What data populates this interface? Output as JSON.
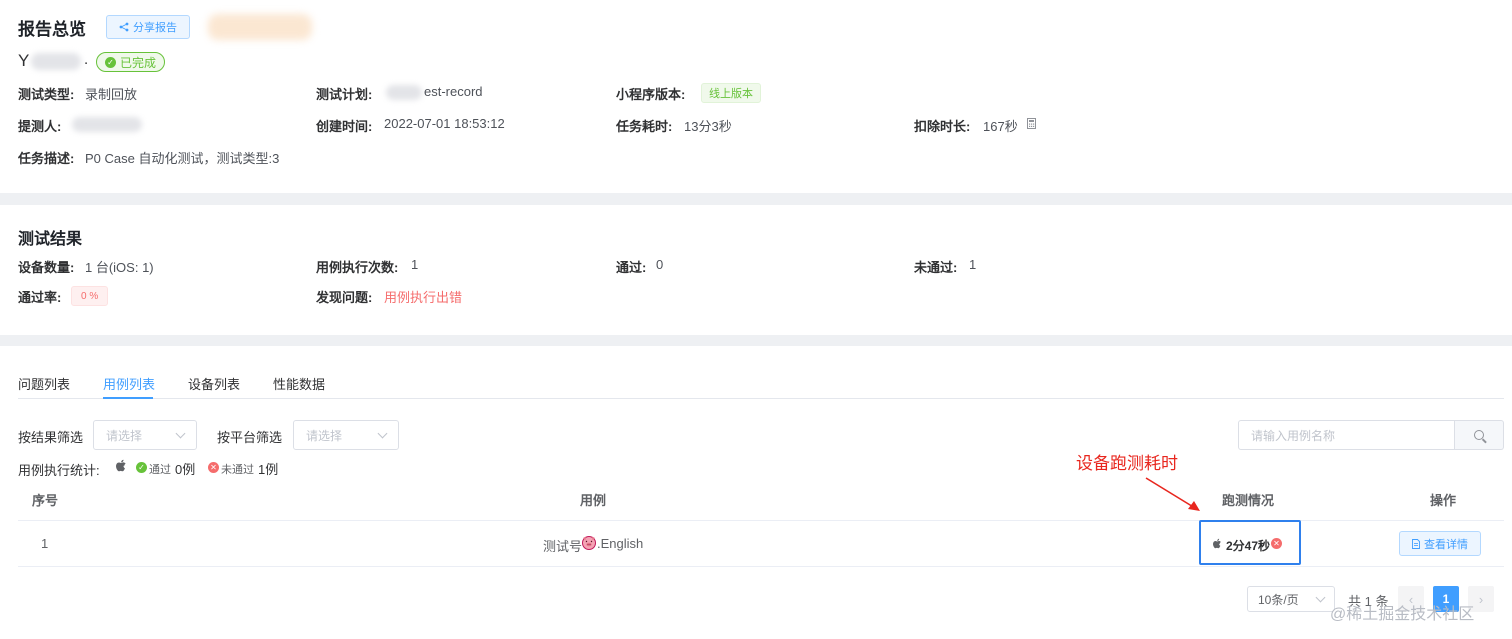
{
  "overview": {
    "title": "报告总览",
    "share_label": "分享报告",
    "name_initial": "Y",
    "name_suffix": ".",
    "status": "已完成",
    "test_type_label": "测试类型:",
    "test_type_value": "录制回放",
    "test_plan_label": "测试计划:",
    "test_plan_value": "est-record",
    "mp_version_label": "小程序版本:",
    "mp_version_value": "线上版本",
    "submitter_label": "提测人:",
    "created_label": "创建时间:",
    "created_value": "2022-07-01 18:53:12",
    "duration_label": "任务耗时:",
    "duration_value": "13分3秒",
    "deduct_label": "扣除时长:",
    "deduct_value": "167秒",
    "desc_label": "任务描述:",
    "desc_value": "P0 Case 自动化测试，测试类型:3"
  },
  "results": {
    "title": "测试结果",
    "devices_label": "设备数量:",
    "devices_value": "1 台(iOS: 1)",
    "exec_label": "用例执行次数:",
    "exec_value": "1",
    "pass_label": "通过:",
    "pass_value": "0",
    "fail_label": "未通过:",
    "fail_value": "1",
    "rate_label": "通过率:",
    "rate_value": "0 %",
    "issue_label": "发现问题:",
    "issue_value": "用例执行出错"
  },
  "tabs": [
    {
      "label": "问题列表",
      "active": false
    },
    {
      "label": "用例列表",
      "active": true
    },
    {
      "label": "设备列表",
      "active": false
    },
    {
      "label": "性能数据",
      "active": false
    }
  ],
  "filters": {
    "result_label": "按结果筛选",
    "result_placeholder": "请选择",
    "platform_label": "按平台筛选",
    "platform_placeholder": "请选择",
    "search_placeholder": "请输入用例名称"
  },
  "stats": {
    "label": "用例执行统计:",
    "pass_text": "通过",
    "pass_count": "0例",
    "fail_text": "未通过",
    "fail_count": "1例"
  },
  "annotation": "设备跑测耗时",
  "table": {
    "headers": {
      "index": "序号",
      "case": "用例",
      "run": "跑测情况",
      "action": "操作"
    },
    "rows": [
      {
        "index": "1",
        "case_prefix": "测试号",
        "case_suffix": ".English",
        "run_time": "2分47秒",
        "action": "查看详情"
      }
    ]
  },
  "pagination": {
    "page_size": "10条/页",
    "total": "共 1 条",
    "current": "1"
  },
  "watermark": "@稀土掘金技术社区",
  "colors": {
    "primary": "#409eff",
    "success": "#67c23a",
    "danger": "#f56c6c",
    "annotation": "#e8261e"
  }
}
